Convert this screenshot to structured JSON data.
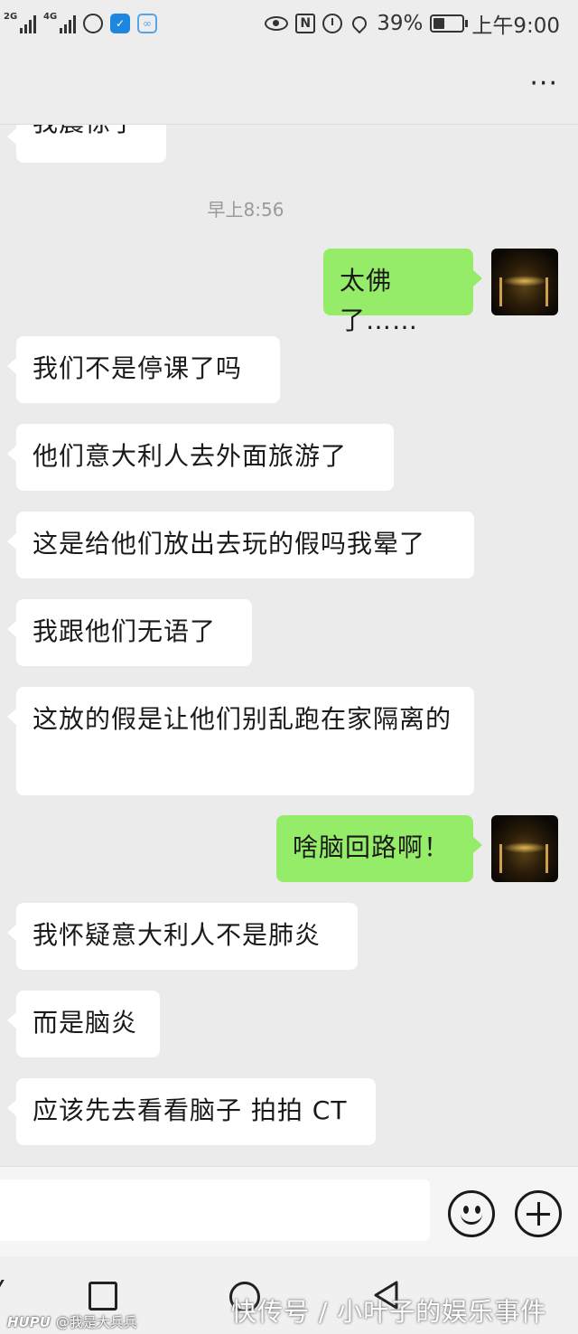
{
  "status_bar": {
    "net1": "2G",
    "net2": "4G",
    "battery": "39%",
    "battery_level": 0.39,
    "time": "上午9:00",
    "icons": [
      "signal-icon",
      "signal-icon",
      "weibo-icon",
      "shield-icon",
      "app-icon",
      "eye-icon",
      "nfc-icon",
      "alarm-icon",
      "location-icon",
      "battery-icon"
    ]
  },
  "header": {
    "more_label": "···"
  },
  "messages": [
    {
      "side": "in",
      "text": "我震惊了"
    },
    {
      "type": "time",
      "text": "早上8:56"
    },
    {
      "side": "out",
      "text": "太佛了……"
    },
    {
      "side": "in",
      "text": "我们不是停课了吗"
    },
    {
      "side": "in",
      "text": "他们意大利人去外面旅游了"
    },
    {
      "side": "in",
      "text": "这是给他们放出去玩的假吗我晕了"
    },
    {
      "side": "in",
      "text": "我跟他们无语了"
    },
    {
      "side": "in",
      "text": "这放的假是让他们别乱跑在家隔离的"
    },
    {
      "side": "out",
      "text": "啥脑回路啊！"
    },
    {
      "side": "in",
      "text": "我怀疑意大利人不是肺炎"
    },
    {
      "side": "in",
      "text": "而是脑炎"
    },
    {
      "side": "in",
      "text": "应该先去看看脑子 拍拍 CT"
    }
  ],
  "input_bar": {
    "value": "",
    "emoji_icon": "smiley-icon",
    "plus_icon": "plus-icon"
  },
  "nav_bar": {
    "icons": [
      "back-icon",
      "recents-icon",
      "home-icon",
      "back-triangle-icon"
    ]
  },
  "watermarks": {
    "left_brand": "HUPU",
    "left_user": "@我是大兵兵",
    "right": "快传号 / 小叶子的娱乐事件"
  },
  "colors": {
    "outgoing_bubble": "#95ec69",
    "incoming_bubble": "#ffffff",
    "background": "#ebebeb"
  }
}
